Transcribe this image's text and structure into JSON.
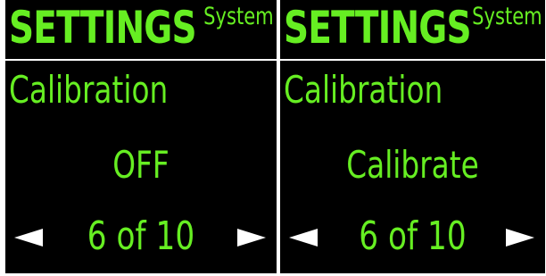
{
  "screens": [
    {
      "header_title": "SETTINGS",
      "header_subtitle": "System",
      "setting_name": "Calibration",
      "value": "OFF",
      "page_indicator": "6 of 10",
      "prev_icon": "arrow-left-icon",
      "next_icon": "arrow-right-icon"
    },
    {
      "header_title": "SETTINGS",
      "header_subtitle": "System",
      "setting_name": "Calibration",
      "value": "Calibrate",
      "page_indicator": "6 of 10",
      "prev_icon": "arrow-left-icon",
      "next_icon": "arrow-right-icon"
    }
  ],
  "colors": {
    "background": "#000000",
    "text": "#66ee22",
    "divider": "#ffffff",
    "arrows": "#ffffff"
  }
}
